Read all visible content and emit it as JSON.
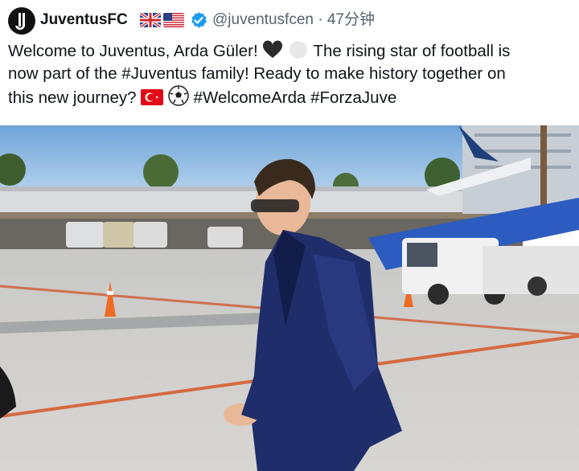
{
  "header": {
    "display_name": "JuventusFC",
    "handle": "@juventusfcen",
    "separator": "·",
    "time_ago": "47分钟",
    "flags": [
      "uk-flag-icon",
      "us-flag-icon"
    ],
    "verified_icon": "verified-badge-icon"
  },
  "tweet": {
    "line1_a": "Welcome to Juventus, Arda Güler!",
    "line1_b": "The rising star of football is",
    "line2": "now part of the #Juventus family! Ready to make history together on",
    "line3_a": "this new journey?",
    "hashtags": "#WelcomeArda #ForzaJuve",
    "emojis": [
      "black-heart-icon",
      "white-heart-icon",
      "turkey-flag-icon",
      "soccer-ball-icon"
    ]
  },
  "colors": {
    "text": "#0f1419",
    "secondary": "#536471",
    "verified": "#1d9bf0",
    "suit": "#1f2d6b",
    "sky": "#9cc6ea"
  },
  "media": {
    "description_icon": "photo-player-at-airport"
  }
}
